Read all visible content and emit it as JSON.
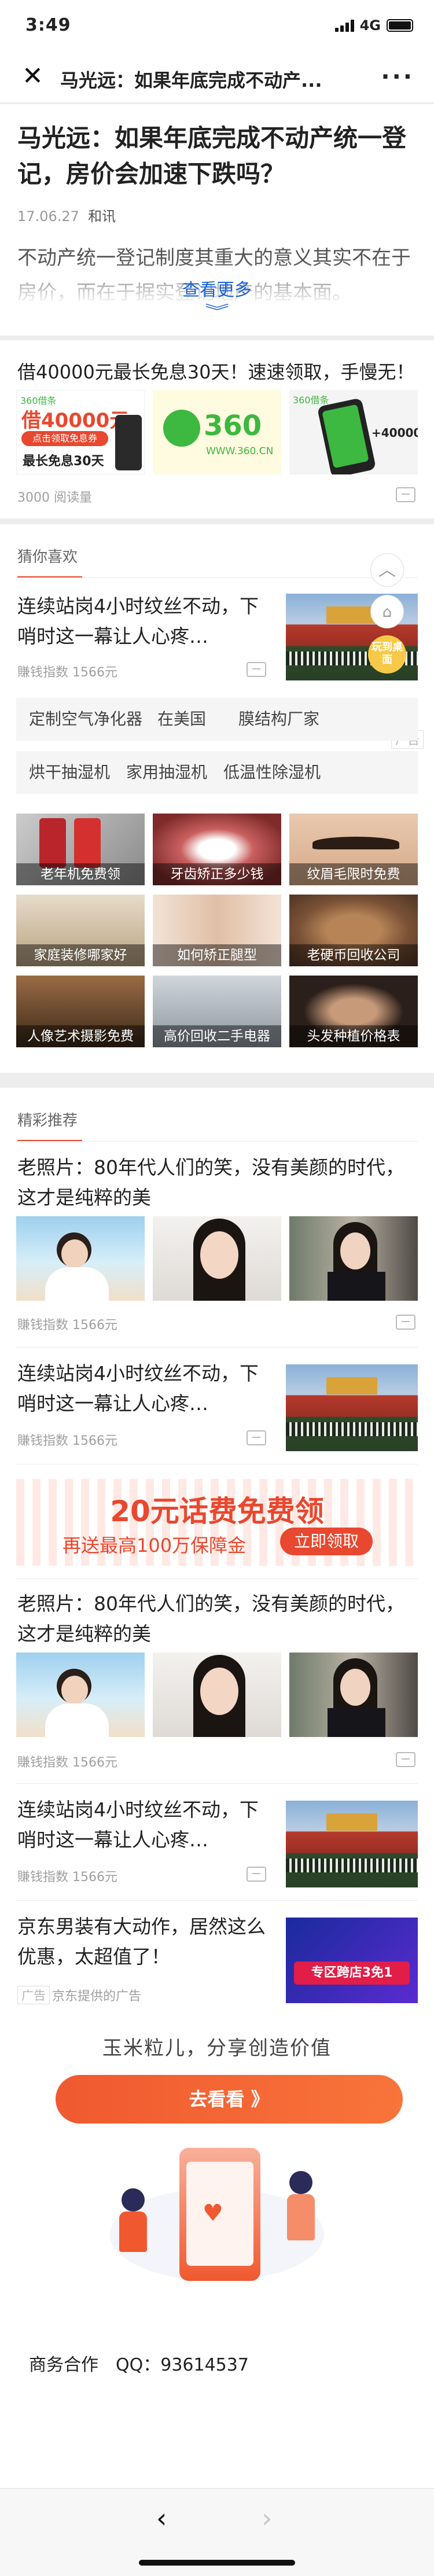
{
  "status_bar": {
    "time": "3:49",
    "network": "4G"
  },
  "nav": {
    "title": "马光远：如果年底完成不动产...",
    "close_icon": "close-icon",
    "more_icon": "more-dots-icon"
  },
  "article": {
    "title": "马光远：如果年底完成不动产统一登记，房价会加速下跌吗？",
    "date": "17.06.27",
    "source": "和讯",
    "excerpt": "不动产统一登记制度其重大的意义其实不在于房价，而在于据实登记地产的基本面。",
    "read_more": "查看更多"
  },
  "ad1": {
    "title": "借40000元最长免息30天！速速领取，手慢无！",
    "img1_brand": "360借条",
    "img1_big": "借40000元",
    "img1_pill": "点击领取免息券",
    "img1_sub": "最长免息30天",
    "img2_logo": "360",
    "img2_url": "WWW.360.CN",
    "img3_brand": "360借条",
    "img3_amount": "+40000",
    "read_count": "3000 阅读量"
  },
  "guess": {
    "section_title": "猜你喜欢",
    "item_title": "连续站岗4小时纹丝不动，下哨时这一幕让人心疼…",
    "item_meta": "賺钱指数 1566元",
    "ad_tag": "广告",
    "float_badge": "玩到桌面",
    "keywords_row1": [
      "定制空气净化器",
      "在美国",
      "膜结构厂家"
    ],
    "keywords_row2": [
      "烘干抽湿机",
      "家用抽湿机",
      "低温性除湿机"
    ],
    "grid_labels": [
      "老年机免费领",
      "牙齿矫正多少钱",
      "纹眉毛限时免费",
      "家庭装修哪家好",
      "如何矫正腿型",
      "老硬币回收公司",
      "人像艺术摄影免费",
      "高价回收二手电器",
      "头发种植价格表"
    ]
  },
  "featured": {
    "section_title": "精彩推荐",
    "items": [
      {
        "title": "老照片：80年代人们的笑，没有美颜的时代，这才是纯粹的美",
        "meta": "賺钱指数 1566元"
      },
      {
        "title": "连续站岗4小时纹丝不动，下哨时这一幕让人心疼…",
        "meta": "賺钱指数 1566元"
      },
      {
        "title": "老照片：80年代人们的笑，没有美颜的时代，这才是纯粹的美",
        "meta": "賺钱指数 1566元"
      },
      {
        "title": "连续站岗4小时纹丝不动，下哨时这一幕让人心疼…",
        "meta": "賺钱指数 1566元"
      }
    ],
    "banner": {
      "line1": "20元话费免费领",
      "line2": "再送最高100万保障金",
      "button": "立即领取"
    },
    "jd": {
      "title": "京东男装有大动作，居然这么优惠，太超值了！",
      "tag": "广告",
      "source": "京东提供的广告",
      "img_text": "专区跨店3免1"
    }
  },
  "footer": {
    "slogan": "玉米粒儿，分享创造价值",
    "button": "去看看 》",
    "contact": "商务合作　QQ：93614537"
  },
  "colors": {
    "accent": "#e8482f",
    "link": "#1a63d8",
    "green": "#3db840"
  }
}
